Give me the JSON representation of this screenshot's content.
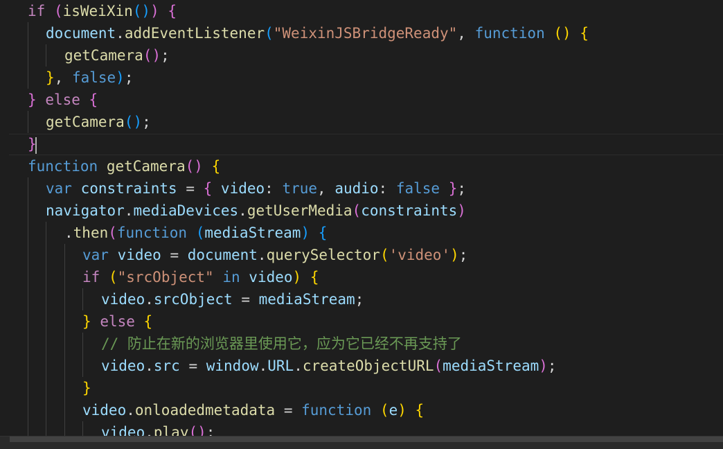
{
  "editor": {
    "language": "javascript",
    "theme_colors": {
      "background": "#1e1e1e",
      "keyword_control": "#c586c0",
      "keyword_storage": "#569cd6",
      "function_name": "#dcdcaa",
      "variable": "#9cdcfe",
      "string": "#ce9178",
      "comment": "#6a9955",
      "plain": "#d4d4d4",
      "bracket_1": "#ffd700",
      "bracket_2": "#da70d6",
      "bracket_3": "#179fff"
    },
    "lines": [
      {
        "indent": 1,
        "tokens": [
          {
            "t": "if",
            "c": "#c586c0"
          },
          {
            "t": " ",
            "c": "#d4d4d4"
          },
          {
            "t": "(",
            "c": "#da70d6"
          },
          {
            "t": "isWeiXin",
            "c": "#dcdcaa"
          },
          {
            "t": "()",
            "c": "#179fff"
          },
          {
            "t": ")",
            "c": "#da70d6"
          },
          {
            "t": " ",
            "c": "#d4d4d4"
          },
          {
            "t": "{",
            "c": "#da70d6"
          }
        ]
      },
      {
        "indent": 2,
        "tokens": [
          {
            "t": "document",
            "c": "#9cdcfe"
          },
          {
            "t": ".",
            "c": "#d4d4d4"
          },
          {
            "t": "addEventListener",
            "c": "#dcdcaa"
          },
          {
            "t": "(",
            "c": "#179fff"
          },
          {
            "t": "\"WeixinJSBridgeReady\"",
            "c": "#ce9178"
          },
          {
            "t": ", ",
            "c": "#d4d4d4"
          },
          {
            "t": "function",
            "c": "#569cd6"
          },
          {
            "t": " ",
            "c": "#d4d4d4"
          },
          {
            "t": "()",
            "c": "#ffd700"
          },
          {
            "t": " ",
            "c": "#d4d4d4"
          },
          {
            "t": "{",
            "c": "#ffd700"
          }
        ]
      },
      {
        "indent": 3,
        "tokens": [
          {
            "t": "getCamera",
            "c": "#dcdcaa"
          },
          {
            "t": "()",
            "c": "#da70d6"
          },
          {
            "t": ";",
            "c": "#d4d4d4"
          }
        ]
      },
      {
        "indent": 2,
        "tokens": [
          {
            "t": "}",
            "c": "#ffd700"
          },
          {
            "t": ", ",
            "c": "#d4d4d4"
          },
          {
            "t": "false",
            "c": "#569cd6"
          },
          {
            "t": ")",
            "c": "#179fff"
          },
          {
            "t": ";",
            "c": "#d4d4d4"
          }
        ]
      },
      {
        "indent": 1,
        "tokens": [
          {
            "t": "}",
            "c": "#da70d6"
          },
          {
            "t": " ",
            "c": "#d4d4d4"
          },
          {
            "t": "else",
            "c": "#c586c0"
          },
          {
            "t": " ",
            "c": "#d4d4d4"
          },
          {
            "t": "{",
            "c": "#da70d6"
          }
        ]
      },
      {
        "indent": 2,
        "tokens": [
          {
            "t": "getCamera",
            "c": "#dcdcaa"
          },
          {
            "t": "()",
            "c": "#179fff"
          },
          {
            "t": ";",
            "c": "#d4d4d4"
          }
        ]
      },
      {
        "indent": 1,
        "tokens": [
          {
            "t": "}",
            "c": "#da70d6"
          }
        ]
      },
      {
        "indent": 1,
        "tokens": [
          {
            "t": "function",
            "c": "#569cd6"
          },
          {
            "t": " ",
            "c": "#d4d4d4"
          },
          {
            "t": "getCamera",
            "c": "#dcdcaa"
          },
          {
            "t": "()",
            "c": "#da70d6"
          },
          {
            "t": " ",
            "c": "#d4d4d4"
          },
          {
            "t": "{",
            "c": "#ffd700"
          }
        ]
      },
      {
        "indent": 2,
        "tokens": [
          {
            "t": "var",
            "c": "#569cd6"
          },
          {
            "t": " ",
            "c": "#d4d4d4"
          },
          {
            "t": "constraints",
            "c": "#9cdcfe"
          },
          {
            "t": " = ",
            "c": "#d4d4d4"
          },
          {
            "t": "{",
            "c": "#da70d6"
          },
          {
            "t": " ",
            "c": "#d4d4d4"
          },
          {
            "t": "video",
            "c": "#9cdcfe"
          },
          {
            "t": ": ",
            "c": "#d4d4d4"
          },
          {
            "t": "true",
            "c": "#569cd6"
          },
          {
            "t": ", ",
            "c": "#d4d4d4"
          },
          {
            "t": "audio",
            "c": "#9cdcfe"
          },
          {
            "t": ": ",
            "c": "#d4d4d4"
          },
          {
            "t": "false",
            "c": "#569cd6"
          },
          {
            "t": " ",
            "c": "#d4d4d4"
          },
          {
            "t": "}",
            "c": "#da70d6"
          },
          {
            "t": ";",
            "c": "#d4d4d4"
          }
        ]
      },
      {
        "indent": 2,
        "tokens": [
          {
            "t": "navigator",
            "c": "#9cdcfe"
          },
          {
            "t": ".",
            "c": "#d4d4d4"
          },
          {
            "t": "mediaDevices",
            "c": "#9cdcfe"
          },
          {
            "t": ".",
            "c": "#d4d4d4"
          },
          {
            "t": "getUserMedia",
            "c": "#dcdcaa"
          },
          {
            "t": "(",
            "c": "#da70d6"
          },
          {
            "t": "constraints",
            "c": "#9cdcfe"
          },
          {
            "t": ")",
            "c": "#da70d6"
          }
        ]
      },
      {
        "indent": 3,
        "tokens": [
          {
            "t": ".",
            "c": "#d4d4d4"
          },
          {
            "t": "then",
            "c": "#dcdcaa"
          },
          {
            "t": "(",
            "c": "#da70d6"
          },
          {
            "t": "function",
            "c": "#569cd6"
          },
          {
            "t": " ",
            "c": "#d4d4d4"
          },
          {
            "t": "(",
            "c": "#179fff"
          },
          {
            "t": "mediaStream",
            "c": "#9cdcfe"
          },
          {
            "t": ")",
            "c": "#179fff"
          },
          {
            "t": " ",
            "c": "#d4d4d4"
          },
          {
            "t": "{",
            "c": "#179fff"
          }
        ]
      },
      {
        "indent": 4,
        "tokens": [
          {
            "t": "var",
            "c": "#569cd6"
          },
          {
            "t": " ",
            "c": "#d4d4d4"
          },
          {
            "t": "video",
            "c": "#9cdcfe"
          },
          {
            "t": " = ",
            "c": "#d4d4d4"
          },
          {
            "t": "document",
            "c": "#9cdcfe"
          },
          {
            "t": ".",
            "c": "#d4d4d4"
          },
          {
            "t": "querySelector",
            "c": "#dcdcaa"
          },
          {
            "t": "(",
            "c": "#ffd700"
          },
          {
            "t": "'video'",
            "c": "#ce9178"
          },
          {
            "t": ")",
            "c": "#ffd700"
          },
          {
            "t": ";",
            "c": "#d4d4d4"
          }
        ]
      },
      {
        "indent": 4,
        "tokens": [
          {
            "t": "if",
            "c": "#c586c0"
          },
          {
            "t": " ",
            "c": "#d4d4d4"
          },
          {
            "t": "(",
            "c": "#ffd700"
          },
          {
            "t": "\"srcObject\"",
            "c": "#ce9178"
          },
          {
            "t": " ",
            "c": "#d4d4d4"
          },
          {
            "t": "in",
            "c": "#569cd6"
          },
          {
            "t": " ",
            "c": "#d4d4d4"
          },
          {
            "t": "video",
            "c": "#9cdcfe"
          },
          {
            "t": ")",
            "c": "#ffd700"
          },
          {
            "t": " ",
            "c": "#d4d4d4"
          },
          {
            "t": "{",
            "c": "#ffd700"
          }
        ]
      },
      {
        "indent": 5,
        "tokens": [
          {
            "t": "video",
            "c": "#9cdcfe"
          },
          {
            "t": ".",
            "c": "#d4d4d4"
          },
          {
            "t": "srcObject",
            "c": "#9cdcfe"
          },
          {
            "t": " = ",
            "c": "#d4d4d4"
          },
          {
            "t": "mediaStream",
            "c": "#9cdcfe"
          },
          {
            "t": ";",
            "c": "#d4d4d4"
          }
        ]
      },
      {
        "indent": 4,
        "tokens": [
          {
            "t": "}",
            "c": "#ffd700"
          },
          {
            "t": " ",
            "c": "#d4d4d4"
          },
          {
            "t": "else",
            "c": "#c586c0"
          },
          {
            "t": " ",
            "c": "#d4d4d4"
          },
          {
            "t": "{",
            "c": "#ffd700"
          }
        ]
      },
      {
        "indent": 5,
        "tokens": [
          {
            "t": "// 防止在新的浏览器里使用它，应为它已经不再支持了",
            "c": "#6a9955"
          }
        ]
      },
      {
        "indent": 5,
        "tokens": [
          {
            "t": "video",
            "c": "#9cdcfe"
          },
          {
            "t": ".",
            "c": "#d4d4d4"
          },
          {
            "t": "src",
            "c": "#9cdcfe"
          },
          {
            "t": " = ",
            "c": "#d4d4d4"
          },
          {
            "t": "window",
            "c": "#9cdcfe"
          },
          {
            "t": ".",
            "c": "#d4d4d4"
          },
          {
            "t": "URL",
            "c": "#9cdcfe"
          },
          {
            "t": ".",
            "c": "#d4d4d4"
          },
          {
            "t": "createObjectURL",
            "c": "#dcdcaa"
          },
          {
            "t": "(",
            "c": "#da70d6"
          },
          {
            "t": "mediaStream",
            "c": "#9cdcfe"
          },
          {
            "t": ")",
            "c": "#da70d6"
          },
          {
            "t": ";",
            "c": "#d4d4d4"
          }
        ]
      },
      {
        "indent": 4,
        "tokens": [
          {
            "t": "}",
            "c": "#ffd700"
          }
        ]
      },
      {
        "indent": 4,
        "tokens": [
          {
            "t": "video",
            "c": "#9cdcfe"
          },
          {
            "t": ".",
            "c": "#d4d4d4"
          },
          {
            "t": "onloadedmetadata",
            "c": "#dcdcaa"
          },
          {
            "t": " = ",
            "c": "#d4d4d4"
          },
          {
            "t": "function",
            "c": "#569cd6"
          },
          {
            "t": " ",
            "c": "#d4d4d4"
          },
          {
            "t": "(",
            "c": "#ffd700"
          },
          {
            "t": "e",
            "c": "#9cdcfe"
          },
          {
            "t": ")",
            "c": "#ffd700"
          },
          {
            "t": " ",
            "c": "#d4d4d4"
          },
          {
            "t": "{",
            "c": "#ffd700"
          }
        ]
      },
      {
        "indent": 5,
        "tokens": [
          {
            "t": "video",
            "c": "#9cdcfe"
          },
          {
            "t": ".",
            "c": "#d4d4d4"
          },
          {
            "t": "play",
            "c": "#dcdcaa"
          },
          {
            "t": "()",
            "c": "#da70d6"
          },
          {
            "t": ";",
            "c": "#d4d4d4"
          }
        ]
      }
    ]
  }
}
